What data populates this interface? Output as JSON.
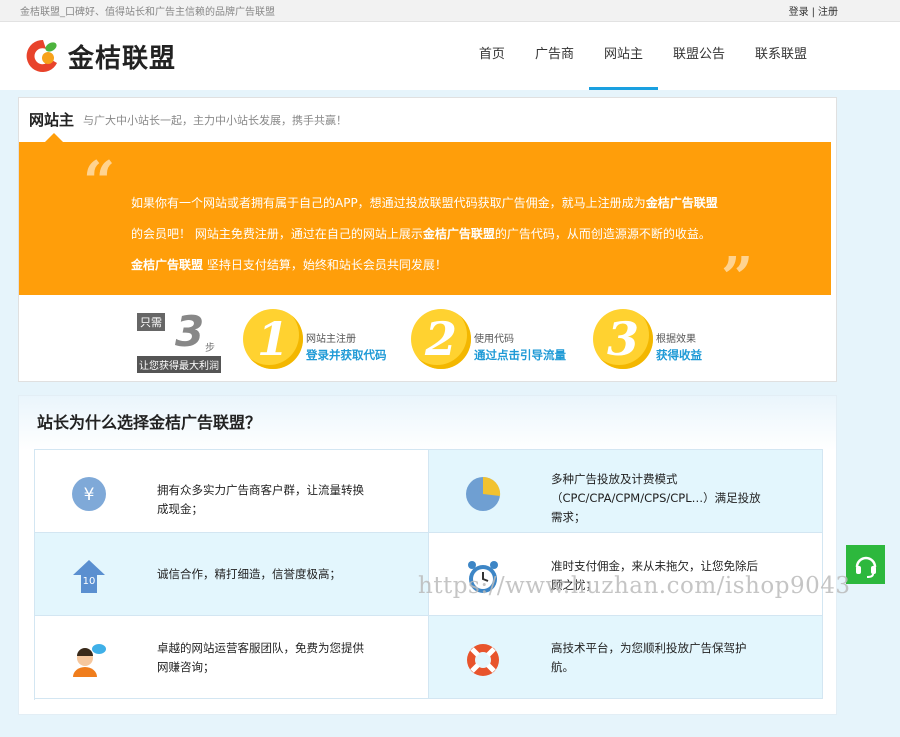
{
  "topbar": {
    "tagline": "金桔联盟_口碑好、值得站长和广告主信赖的品牌广告联盟",
    "login": "登录",
    "separator": "|",
    "register": "注册"
  },
  "header": {
    "logo_text": "金桔联盟",
    "nav": [
      "首页",
      "广告商",
      "网站主",
      "联盟公告",
      "联系联盟"
    ],
    "active_nav": "网站主"
  },
  "webmaster": {
    "title": "网站主",
    "subtitle": "与广大中小站长一起，主力中小站长发展，携手共赢！",
    "intro": {
      "l1a": "如果你有一个网站或者拥有属于自己的APP，想通过投放联盟代码获取广告佣金，就马上注册成为",
      "l1b": "金桔广告联盟",
      "l2a": "的会员吧！ 网站主免费注册，通过在自己的网站上展示",
      "l2b": "金桔广告联盟",
      "l2c": "的广告代码，从而创造源源不断的收益。",
      "l3a": "金桔广告联盟",
      "l3b": " 坚持日支付结算，始终和站长会员共同发展！"
    },
    "badge": {
      "prefix": "只需",
      "number": "3",
      "unit": "步",
      "caption": "让您获得最大利润"
    },
    "steps": [
      {
        "num": "1",
        "label": "网站主注册",
        "action": "登录并获取代码"
      },
      {
        "num": "2",
        "label": "使用代码",
        "action": "通过点击引导流量"
      },
      {
        "num": "3",
        "label": "根据效果",
        "action": "获得收益"
      }
    ]
  },
  "why": {
    "title": "站长为什么选择金桔广告联盟？",
    "features": [
      {
        "icon": "yen-coin-icon",
        "text": "拥有众多实力广告商客户群，让流量转换成现金；"
      },
      {
        "icon": "pie-chart-icon",
        "text": "多种广告投放及计费模式（CPC/CPA/CPM/CPS/CPL…）满足投放需求；"
      },
      {
        "icon": "growth-arrow-icon",
        "text": "诚信合作，精打细造，信誉度极高；"
      },
      {
        "icon": "alarm-clock-icon",
        "text": "准时支付佣金，来从未拖欠，让您免除后顾之忧；"
      },
      {
        "icon": "support-agent-icon",
        "text": "卓越的网站运营客服团队，免费为您提供网赚咨询；"
      },
      {
        "icon": "lifebuoy-icon",
        "text": "高技术平台，为您顺利投放广告保驾护航。"
      }
    ]
  },
  "watermark": "https://www.huzhan.com/ishop9043",
  "colors": {
    "orange": "#ff9e0a",
    "accent_blue": "#1aa0e0",
    "step_yellow": "#ffd230",
    "support_green": "#2db83d"
  }
}
